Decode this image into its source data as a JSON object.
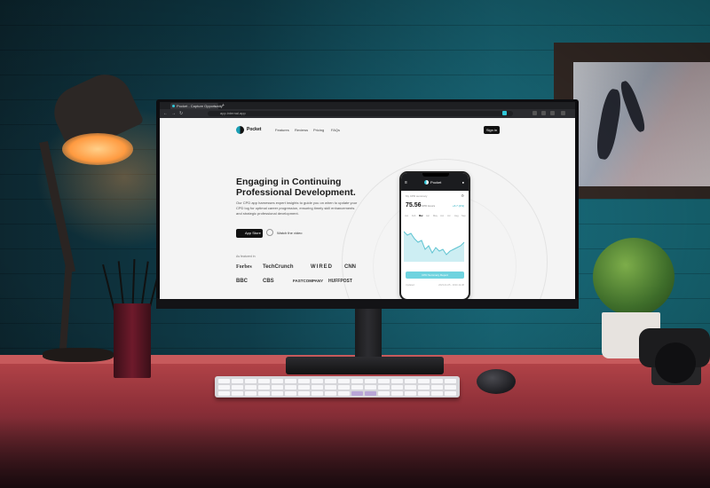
{
  "browser": {
    "tab_title": "Pocket - Capture Opportunity",
    "tab_close": "×",
    "new_tab": "+",
    "url": "app.internal.app",
    "nav": {
      "back": "←",
      "forward": "→",
      "reload": "↻"
    }
  },
  "site": {
    "brand": "Pocket",
    "nav": [
      "Features",
      "Reviews",
      "Pricing",
      "FAQs"
    ],
    "signin_label": "Sign in",
    "hero_title": "Engaging in Continuing Professional Development.",
    "hero_description": "Our CPD app harnesses expert insights to guide you on when to update your CPD log for optimal career progression, ensuring timely skill enhancements and strategic professional development.",
    "appstore_label": "App Store",
    "watch_label": "Watch the video",
    "featured_label": "As featured in",
    "press_logos": [
      "Forbes",
      "TechCrunch",
      "WIRED",
      "CNN",
      "BBC",
      "CBS",
      "FASTCOMPANY",
      "HUFFPOST"
    ]
  },
  "phone": {
    "menu_icon": "≡",
    "brand": "Pocket",
    "user_icon": "●",
    "section_label": "My CPD summary",
    "gear_icon": "⚙",
    "value": "75.56",
    "unit": "CPD Hours",
    "delta": "+6.7 (2%)",
    "months": [
      "Jan",
      "Feb",
      "Mar",
      "Apr",
      "May",
      "Jun",
      "Jul",
      "Aug",
      "Sep"
    ],
    "active_month": "Mar",
    "cta": "CPD Summary Report",
    "footer_left": "Updated",
    "footer_right": "2023-01-05 - 2023-12-08"
  },
  "colors": {
    "accent": "#30c7d9",
    "chart_line": "#5dc3d1",
    "chart_fill": "#cdeef3"
  }
}
